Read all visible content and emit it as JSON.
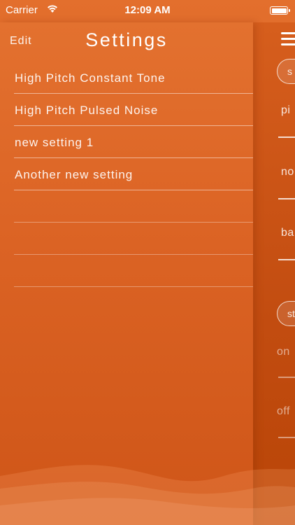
{
  "status_bar": {
    "carrier": "Carrier",
    "time": "12:09 AM",
    "battery_level": 1.0,
    "wifi_icon": "wifi-icon",
    "battery_icon": "battery-icon"
  },
  "nav": {
    "edit_label": "Edit",
    "title": "Settings"
  },
  "settings_list": {
    "items": [
      {
        "label": "High Pitch Constant Tone"
      },
      {
        "label": "High Pitch Pulsed Noise"
      },
      {
        "label": "new setting 1"
      },
      {
        "label": "Another new setting"
      }
    ],
    "empty_rows": 3
  },
  "side_panel": {
    "menu_icon": "hamburger-menu-icon",
    "top_pill_text": "s",
    "labels": {
      "pitch": "pi",
      "noise": "no",
      "balance": "ba",
      "mode_pill_text": "st",
      "on": "on",
      "off": "off"
    }
  },
  "colors": {
    "accent": "#e06a28",
    "panel": "#c24c10",
    "text": "#ffffff"
  }
}
